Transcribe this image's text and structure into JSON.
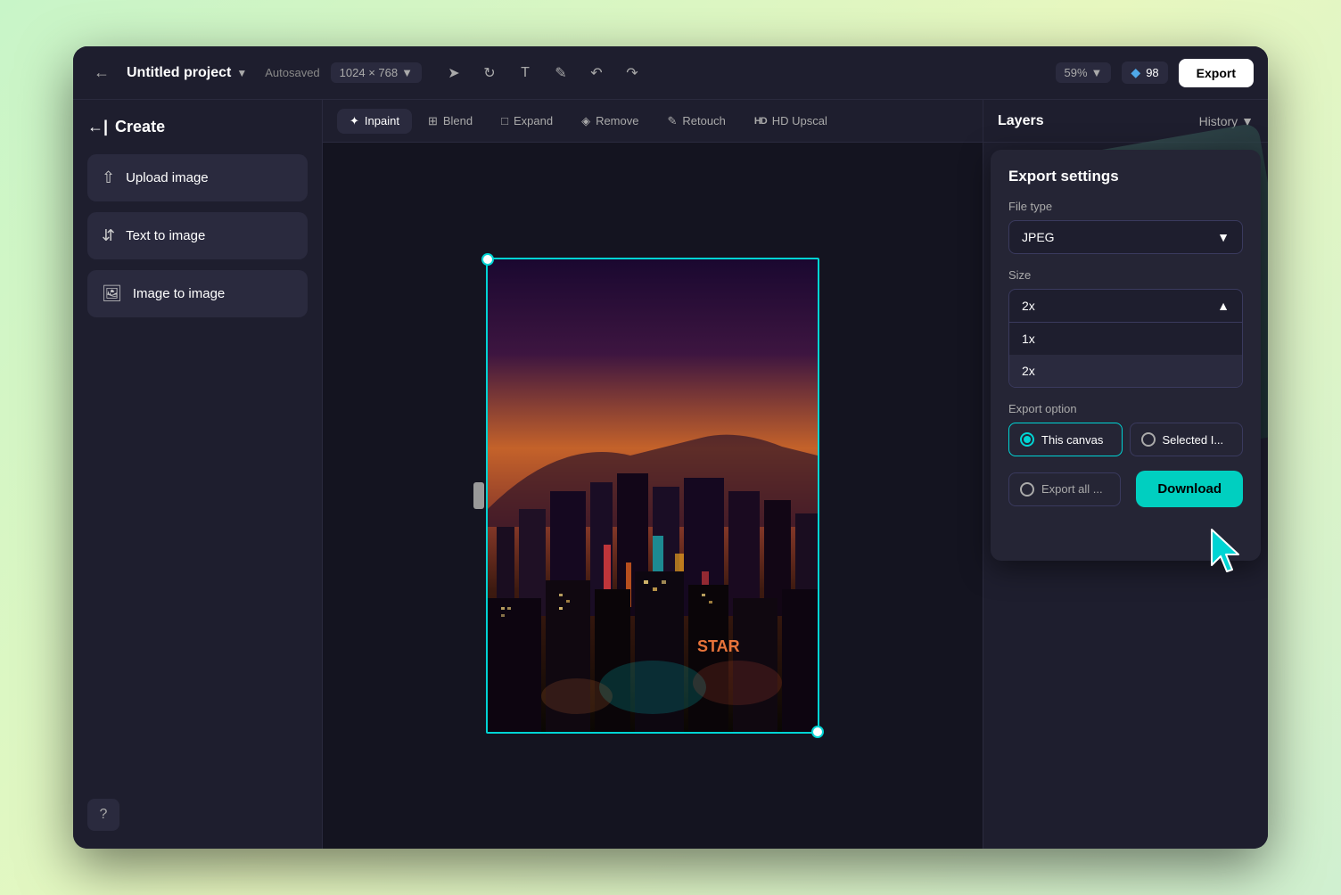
{
  "app": {
    "title": "Untitled project",
    "autosaved": "Autosaved",
    "canvas_size": "1024 × 768",
    "zoom": "59%",
    "credits": "98",
    "export_btn": "Export"
  },
  "toolbar": {
    "tabs": [
      {
        "label": "Inpaint",
        "icon": "✦",
        "active": true
      },
      {
        "label": "Blend",
        "icon": "⊞",
        "active": false
      },
      {
        "label": "Expand",
        "icon": "⊡",
        "active": false
      },
      {
        "label": "Remove",
        "icon": "◇",
        "active": false
      },
      {
        "label": "Retouch",
        "icon": "✒",
        "active": false
      },
      {
        "label": "HD Upscal",
        "icon": "HD",
        "active": false
      }
    ]
  },
  "sidebar": {
    "create_label": "Create",
    "buttons": [
      {
        "label": "Upload image",
        "icon": "⬆"
      },
      {
        "label": "Text to image",
        "icon": "⌨"
      },
      {
        "label": "Image to image",
        "icon": "🖼"
      }
    ]
  },
  "right_panel": {
    "layers_tab": "Layers",
    "history_tab": "History"
  },
  "export_settings": {
    "title": "Export settings",
    "file_type_label": "File type",
    "file_type_value": "JPEG",
    "size_label": "Size",
    "size_value": "2x",
    "size_options": [
      "1x",
      "2x"
    ],
    "export_option_label": "Export option",
    "this_canvas": "This canvas",
    "selected": "Selected I...",
    "export_all": "Export all ...",
    "download_btn": "Download"
  }
}
